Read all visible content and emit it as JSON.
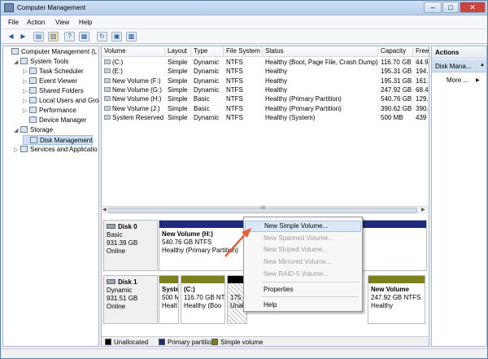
{
  "window": {
    "title": "Computer Management",
    "minimize": "–",
    "maximize": "□",
    "close": "✕",
    "close_color": "#c9453a"
  },
  "menu": [
    "File",
    "Action",
    "View",
    "Help"
  ],
  "tree": [
    {
      "label": "Computer Management (L",
      "level": 0,
      "expander": "",
      "icon": "computer-icon"
    },
    {
      "label": "System Tools",
      "level": 1,
      "expander": "◢",
      "icon": "tools-icon"
    },
    {
      "label": "Task Scheduler",
      "level": 2,
      "expander": "▷",
      "icon": "clock-icon"
    },
    {
      "label": "Event Viewer",
      "level": 2,
      "expander": "▷",
      "icon": "event-icon"
    },
    {
      "label": "Shared Folders",
      "level": 2,
      "expander": "▷",
      "icon": "folder-icon"
    },
    {
      "label": "Local Users and Gro",
      "level": 2,
      "expander": "▷",
      "icon": "users-icon"
    },
    {
      "label": "Performance",
      "level": 2,
      "expander": "▷",
      "icon": "performance-icon"
    },
    {
      "label": "Device Manager",
      "level": 2,
      "expander": "",
      "icon": "device-icon"
    },
    {
      "label": "Storage",
      "level": 1,
      "expander": "◢",
      "icon": "storage-icon"
    },
    {
      "label": "Disk Management",
      "level": 2,
      "expander": "",
      "icon": "disk-icon"
    },
    {
      "label": "Services and Applicatio",
      "level": 1,
      "expander": "▷",
      "icon": "services-icon"
    }
  ],
  "columns": [
    "Volume",
    "Layout",
    "Type",
    "File System",
    "Status",
    "Capacity",
    "Free"
  ],
  "volumes": [
    [
      "(C:)",
      "Simple",
      "Dynamic",
      "NTFS",
      "Healthy (Boot, Page File, Crash Dump)",
      "116.70 GB",
      "44.9"
    ],
    [
      "(E:)",
      "Simple",
      "Dynamic",
      "NTFS",
      "Healthy",
      "195.31 GB",
      "194."
    ],
    [
      "New Volume (F:)",
      "Simple",
      "Dynamic",
      "NTFS",
      "Healthy",
      "195.31 GB",
      "161."
    ],
    [
      "New Volume (G:)",
      "Simple",
      "Dynamic",
      "NTFS",
      "Healthy",
      "247.92 GB",
      "68.4"
    ],
    [
      "New Volume (H:)",
      "Simple",
      "Basic",
      "NTFS",
      "Healthy (Primary Partition)",
      "540.76 GB",
      "129."
    ],
    [
      "New Volume (J:)",
      "Simple",
      "Basic",
      "NTFS",
      "Healthy (Primary Partition)",
      "390.62 GB",
      "390."
    ],
    [
      "System Reserved",
      "Simple",
      "Dynamic",
      "NTFS",
      "Healthy (System)",
      "500 MB",
      "439"
    ]
  ],
  "disks": [
    {
      "name": "Disk 0",
      "type": "Basic",
      "size": "931.39 GB",
      "status": "Online",
      "parts": [
        {
          "l1": "New Volume  (H:)",
          "l2": "540.76 GB NTFS",
          "l3": "Healthy (Primary Partition)"
        }
      ]
    },
    {
      "name": "Disk 1",
      "type": "Dynamic",
      "size": "931.51 GB",
      "status": "Online",
      "parts": [
        {
          "l1": "Syste",
          "l2": "500 M",
          "l3": "Healt"
        },
        {
          "l1": "(C:)",
          "l2": "116.70 GB NTFS",
          "l3": "Healthy (Boo"
        },
        {
          "l1": "",
          "l2": "175.7",
          "l3": "Unall"
        },
        {
          "l1": "New Volume",
          "l2": "247.92 GB NTFS",
          "l3": "Healthy"
        }
      ]
    }
  ],
  "legend": [
    {
      "label": "Unallocated",
      "color": "#000000"
    },
    {
      "label": "Primary partition",
      "color": "#1e2a80"
    },
    {
      "label": "Simple volume",
      "color": "#7f7f1f"
    }
  ],
  "actions": {
    "header": "Actions",
    "section": "Disk Mana...",
    "section_arrow": "▲",
    "more": "More ...",
    "more_arrow": "▶"
  },
  "context_menu": [
    {
      "label": "New Simple Volume...",
      "enabled": true,
      "highlighted": true
    },
    {
      "label": "New Spanned Volume...",
      "enabled": false
    },
    {
      "label": "New Striped Volume...",
      "enabled": false
    },
    {
      "label": "New Mirrored Volume...",
      "enabled": false
    },
    {
      "label": "New RAID-5 Volume...",
      "enabled": false
    },
    {
      "label": "Properties",
      "enabled": true
    },
    {
      "label": "Help",
      "enabled": true
    }
  ],
  "accent": {
    "arrow": "#e5603a",
    "primary": "#1e2a80",
    "simple": "#7f7f1f"
  }
}
